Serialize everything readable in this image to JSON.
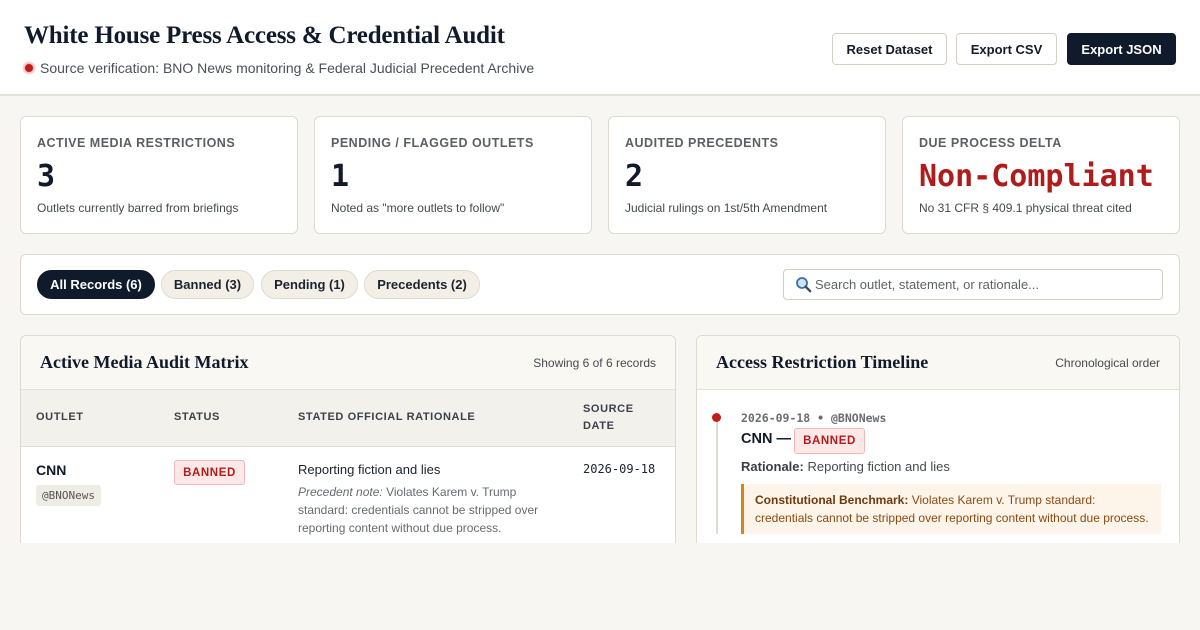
{
  "header": {
    "title": "White House Press Access & Credential Audit",
    "source_label": "Source verification: BNO News monitoring & Federal Judicial Precedent Archive",
    "buttons": {
      "reset": "Reset Dataset",
      "export_csv": "Export CSV",
      "export_json": "Export JSON"
    }
  },
  "stats": [
    {
      "label": "ACTIVE MEDIA RESTRICTIONS",
      "value": "3",
      "desc": "Outlets currently barred from briefings"
    },
    {
      "label": "PENDING / FLAGGED OUTLETS",
      "value": "1",
      "desc": "Noted as \"more outlets to follow\""
    },
    {
      "label": "AUDITED PRECEDENTS",
      "value": "2",
      "desc": "Judicial rulings on 1st/5th Amendment"
    },
    {
      "label": "DUE PROCESS DELTA",
      "value": "Non-Compliant",
      "desc": "No 31 CFR § 409.1 physical threat cited",
      "value_color": "#b01c1c"
    }
  ],
  "filters": {
    "tabs": [
      "All Records (6)",
      "Banned (3)",
      "Pending (1)",
      "Precedents (2)"
    ],
    "active_tab": "All Records (6)",
    "search_placeholder": "Search outlet, statement, or rationale..."
  },
  "matrix": {
    "title": "Active Media Audit Matrix",
    "meta": "Showing 6 of 6 records",
    "columns": [
      "OUTLET",
      "STATUS",
      "STATED OFFICIAL RATIONALE",
      "SOURCE DATE"
    ],
    "rows": [
      {
        "outlet": "CNN",
        "handle": "@BNONews",
        "status": "BANNED",
        "rationale": "Reporting fiction and lies",
        "note_label": "Precedent note:",
        "note": "Violates Karem v. Trump standard: credentials cannot be stripped over reporting content without due process.",
        "date": "2026-09-18"
      }
    ]
  },
  "timeline": {
    "title": "Access Restriction Timeline",
    "meta": "Chronological order",
    "events": [
      {
        "date_source": "2026-09-18 • @BNONews",
        "outlet": "CNN —",
        "status": "BANNED",
        "rationale_label": "Rationale:",
        "rationale": "Reporting fiction and lies",
        "benchmark_label": "Constitutional Benchmark:",
        "benchmark": "Violates Karem v. Trump standard: credentials cannot be stripped over reporting content without due process."
      }
    ]
  },
  "colors": {
    "navy": "#0f1a2b",
    "alert_red": "#b01c1c",
    "benchmark_orange": "#d4861a"
  },
  "icons": {
    "search": "search-icon",
    "source_indicator": "red-dot-icon",
    "timeline_marker": "timeline-dot-icon"
  }
}
